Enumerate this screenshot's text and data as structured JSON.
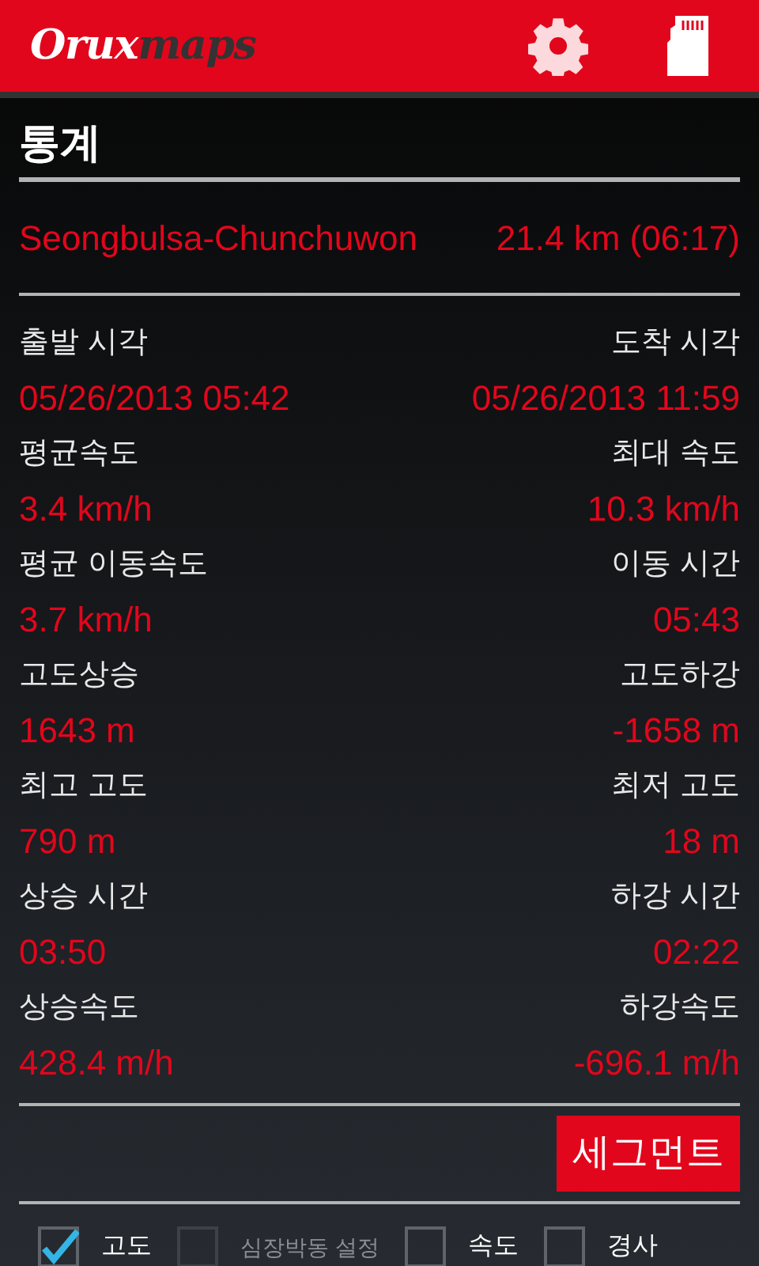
{
  "app_bar": {
    "logo": {
      "part_1": "Orux",
      "part_2": "maps"
    }
  },
  "title": "통계",
  "track": {
    "name": "Seongbulsa-Chunchuwon",
    "summary": "21.4 km (06:17)"
  },
  "stats": [
    {
      "left_label": "출발 시각",
      "left_value": "05/26/2013 05:42",
      "right_label": "도착 시각",
      "right_value": "05/26/2013 11:59"
    },
    {
      "left_label": "평균속도",
      "left_value": "3.4 km/h",
      "right_label": "최대 속도",
      "right_value": "10.3 km/h"
    },
    {
      "left_label": "평균 이동속도",
      "left_value": "3.7 km/h",
      "right_label": "이동 시간",
      "right_value": "05:43"
    },
    {
      "left_label": "고도상승",
      "left_value": "1643 m",
      "right_label": "고도하강",
      "right_value": "-1658 m"
    },
    {
      "left_label": "최고 고도",
      "left_value": "790 m",
      "right_label": "최저 고도",
      "right_value": "18 m"
    },
    {
      "left_label": "상승 시간",
      "left_value": "03:50",
      "right_label": "하강 시간",
      "right_value": "02:22"
    },
    {
      "left_label": "상승속도",
      "left_value": "428.4 m/h",
      "right_label": "하강속도",
      "right_value": "-696.1 m/h"
    }
  ],
  "segment_button": "세그먼트",
  "chart_options": [
    {
      "label": "고도",
      "checked": true,
      "disabled": false
    },
    {
      "label": "심장박동 설정",
      "checked": false,
      "disabled": true
    },
    {
      "label": "속도",
      "checked": false,
      "disabled": false
    },
    {
      "label": "경사",
      "checked": false,
      "disabled": false
    }
  ]
}
